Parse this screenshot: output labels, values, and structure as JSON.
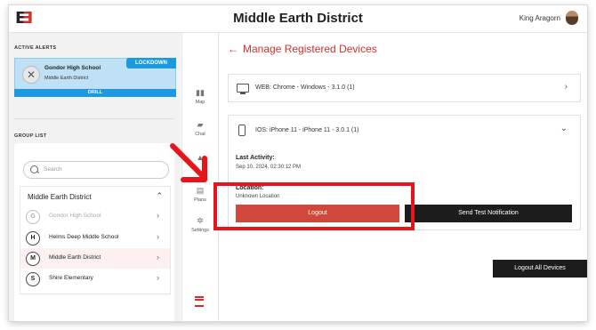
{
  "header": {
    "logo_left": "E",
    "logo_right": "E",
    "title": "Middle Earth District",
    "user_name": "King Aragorn"
  },
  "sidebar": {
    "active_alerts_heading": "ACTIVE ALERTS",
    "alert": {
      "school": "Gondor High School",
      "district": "Middle Earth District",
      "badge": "LOCKDOWN",
      "type": "DRILL",
      "badge_color": "#1a9be0"
    },
    "group_list_heading": "GROUP LIST",
    "search_placeholder": "Search",
    "group_name": "Middle Earth District",
    "items": [
      {
        "initial": "G",
        "label": "Gondor High School",
        "dimmed": true
      },
      {
        "initial": "H",
        "label": "Helms Deep Middle School",
        "dimmed": false
      },
      {
        "initial": "M",
        "label": "Middle Earth District",
        "dimmed": false,
        "selected": true
      },
      {
        "initial": "S",
        "label": "Shire Elementary",
        "dimmed": false
      }
    ]
  },
  "nav": {
    "items": [
      {
        "label": "Map",
        "icon": "map-icon"
      },
      {
        "label": "Chat",
        "icon": "chat-icon"
      },
      {
        "label": "Plans",
        "icon": "plans-icon"
      },
      {
        "label": "Settings",
        "icon": "gear-icon"
      }
    ]
  },
  "main": {
    "back_label": "Manage Registered Devices",
    "devices": [
      {
        "label": "WEB: Chrome - Windows - 3.1.0 (1)",
        "icon": "monitor-icon",
        "expanded": false
      },
      {
        "label": "IOS: iPhone 11 - iPhone 11 - 3.0.1 (1)",
        "icon": "phone-icon",
        "expanded": true,
        "last_activity_label": "Last Activity:",
        "last_activity_value": "Sep 10, 2024, 02:30:12 PM",
        "location_label": "Location:",
        "location_value": "Unknown Location",
        "logout_label": "Logout",
        "test_label": "Send Test Notification"
      }
    ],
    "logout_all_label": "Logout All Devices"
  },
  "colors": {
    "accent_red": "#d0312d",
    "highlight_red": "#e8141c",
    "dark_button": "#1c1c1c"
  }
}
